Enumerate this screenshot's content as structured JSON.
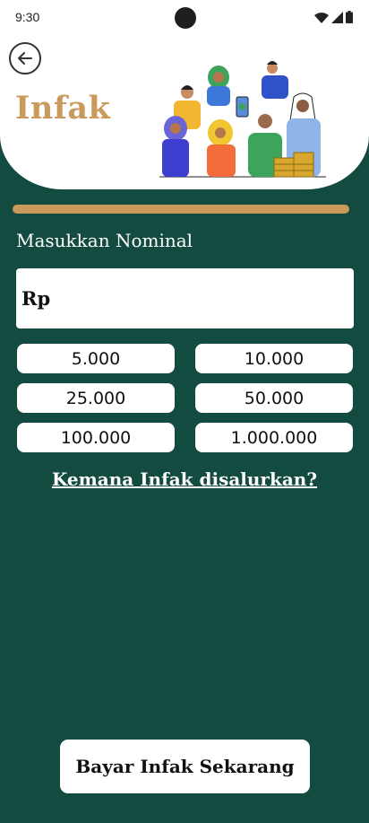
{
  "status_bar": {
    "time": "9:30"
  },
  "header": {
    "title": "Infak"
  },
  "form": {
    "label": "Masukkan Nominal",
    "prefix": "Rp",
    "value": ""
  },
  "amounts": [
    "5.000",
    "10.000",
    "25.000",
    "50.000",
    "100.000",
    "1.000.000"
  ],
  "info_link": "Kemana Infak disalurkan?",
  "pay_button": "Bayar Infak Sekarang",
  "colors": {
    "background": "#134b40",
    "accent": "#c99a5b",
    "surface": "#ffffff"
  }
}
